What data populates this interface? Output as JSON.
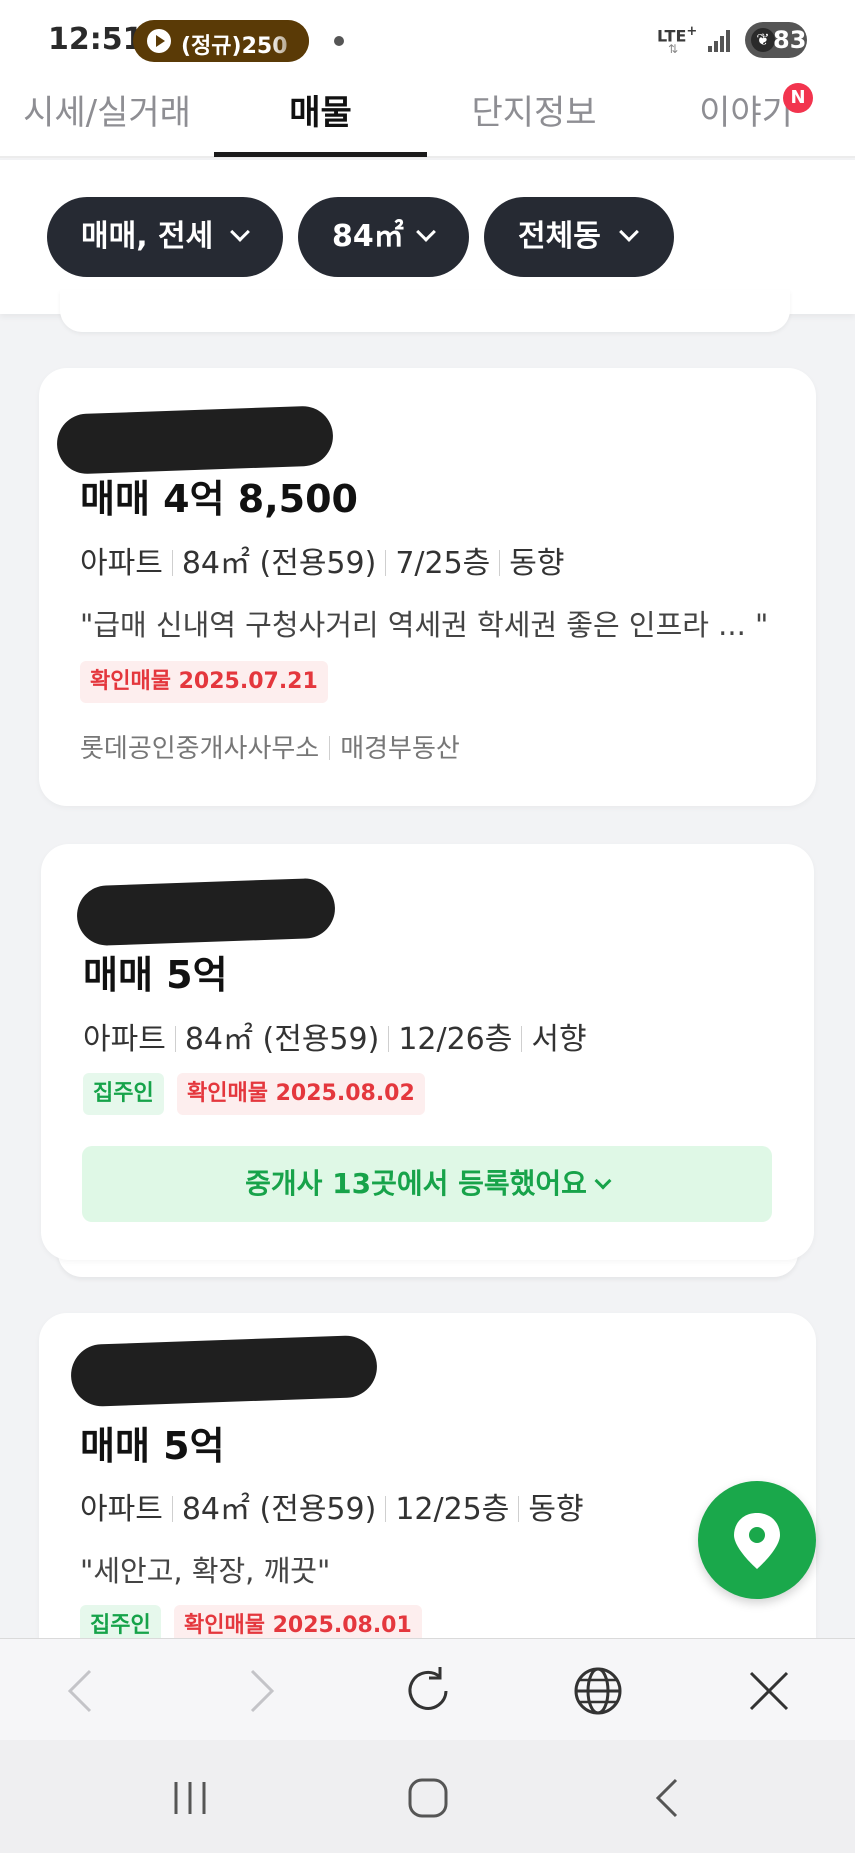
{
  "status_bar": {
    "time": "12:51",
    "media_title": "(정규)250",
    "network": "LTE",
    "network_sup": "+",
    "battery": "83"
  },
  "tabs": [
    {
      "label": "시세/실거래",
      "active": false
    },
    {
      "label": "매물",
      "active": true
    },
    {
      "label": "단지정보",
      "active": false
    },
    {
      "label": "이야기",
      "active": false
    }
  ],
  "tab_badge": "N",
  "filters": [
    {
      "label": "매매, 전세"
    },
    {
      "label": "84㎡"
    },
    {
      "label": "전체동"
    }
  ],
  "listings": [
    {
      "price": "매매 4억 8,500",
      "details": [
        "아파트",
        "84㎡ (전용59)",
        "7/25층",
        "동향"
      ],
      "description": "\"급매 신내역 구청사거리 역세권 학세권 좋은 인프라 ... \"",
      "tags": [
        {
          "text": "확인매물 2025.07.21",
          "color": "red"
        }
      ],
      "agency": [
        "롯데공인중개사사무소",
        "매경부동산"
      ]
    },
    {
      "price": "매매 5억",
      "details": [
        "아파트",
        "84㎡ (전용59)",
        "12/26층",
        "서향"
      ],
      "tags": [
        {
          "text": "집주인",
          "color": "green"
        },
        {
          "text": "확인매물 2025.08.02",
          "color": "red"
        }
      ],
      "agent_banner": "중개사 13곳에서 등록했어요"
    },
    {
      "price": "매매 5억",
      "details": [
        "아파트",
        "84㎡ (전용59)",
        "12/25층",
        "동향"
      ],
      "description": "\"세안고, 확장, 깨끗\"",
      "tags": [
        {
          "text": "집주인",
          "color": "green"
        },
        {
          "text": "확인매물 2025.08.01",
          "color": "red"
        }
      ]
    }
  ],
  "icons": {
    "map_fab": "location-pin-icon",
    "browser": [
      "back-arrow-icon",
      "forward-arrow-icon",
      "refresh-icon",
      "globe-icon",
      "close-icon"
    ],
    "system_nav": [
      "recent-apps-icon",
      "home-icon",
      "system-back-icon"
    ]
  },
  "colors": {
    "accent_green": "#1aa84b",
    "confirm_red": "#e4373d",
    "chip_dark": "#262a33",
    "badge_red": "#f2344e"
  }
}
